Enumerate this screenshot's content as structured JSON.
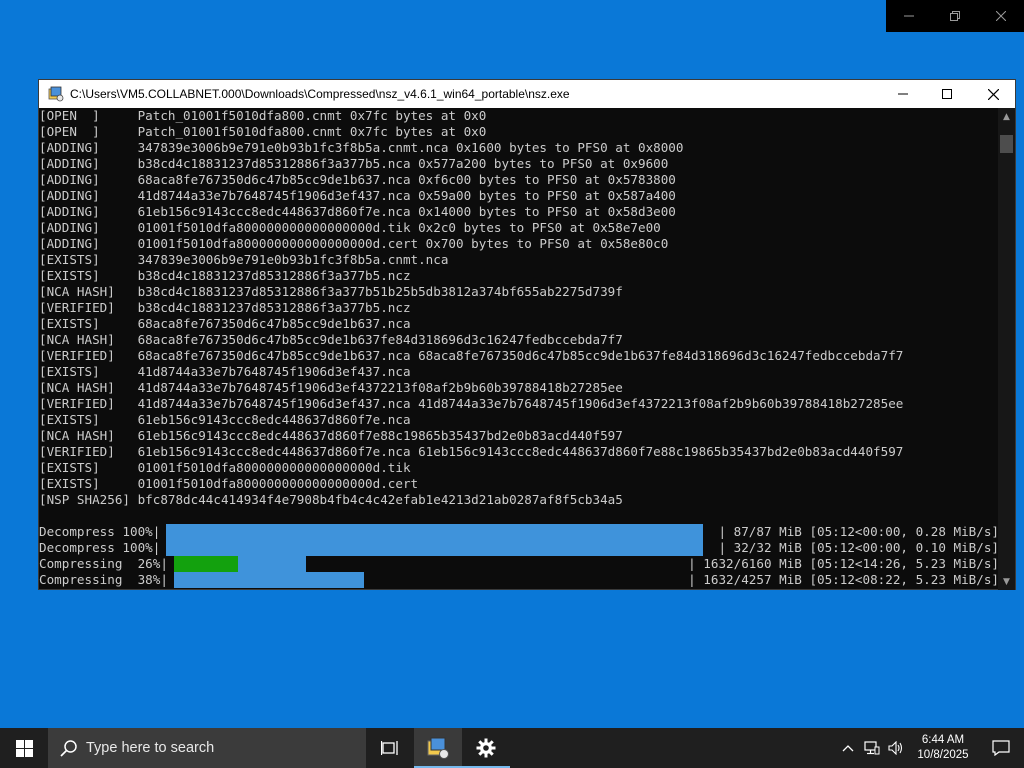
{
  "window": {
    "title": "C:\\Users\\VM5.COLLABNET.000\\Downloads\\Compressed\\nsz_v4.6.1_win64_portable\\nsz.exe"
  },
  "console_lines": [
    "[OPEN  ]     Patch_01001f5010dfa800.cnmt 0x7fc bytes at 0x0",
    "[OPEN  ]     Patch_01001f5010dfa800.cnmt 0x7fc bytes at 0x0",
    "[ADDING]     347839e3006b9e791e0b93b1fc3f8b5a.cnmt.nca 0x1600 bytes to PFS0 at 0x8000",
    "[ADDING]     b38cd4c18831237d85312886f3a377b5.nca 0x577a200 bytes to PFS0 at 0x9600",
    "[ADDING]     68aca8fe767350d6c47b85cc9de1b637.nca 0xf6c00 bytes to PFS0 at 0x5783800",
    "[ADDING]     41d8744a33e7b7648745f1906d3ef437.nca 0x59a00 bytes to PFS0 at 0x587a400",
    "[ADDING]     61eb156c9143ccc8edc448637d860f7e.nca 0x14000 bytes to PFS0 at 0x58d3e00",
    "[ADDING]     01001f5010dfa800000000000000000d.tik 0x2c0 bytes to PFS0 at 0x58e7e00",
    "[ADDING]     01001f5010dfa800000000000000000d.cert 0x700 bytes to PFS0 at 0x58e80c0",
    "[EXISTS]     347839e3006b9e791e0b93b1fc3f8b5a.cnmt.nca",
    "[EXISTS]     b38cd4c18831237d85312886f3a377b5.ncz",
    "[NCA HASH]   b38cd4c18831237d85312886f3a377b51b25b5db3812a374bf655ab2275d739f",
    "[VERIFIED]   b38cd4c18831237d85312886f3a377b5.ncz",
    "[EXISTS]     68aca8fe767350d6c47b85cc9de1b637.nca",
    "[NCA HASH]   68aca8fe767350d6c47b85cc9de1b637fe84d318696d3c16247fedbccebda7f7",
    "[VERIFIED]   68aca8fe767350d6c47b85cc9de1b637.nca 68aca8fe767350d6c47b85cc9de1b637fe84d318696d3c16247fedbccebda7f7",
    "[EXISTS]     41d8744a33e7b7648745f1906d3ef437.nca",
    "[NCA HASH]   41d8744a33e7b7648745f1906d3ef4372213f08af2b9b60b39788418b27285ee",
    "[VERIFIED]   41d8744a33e7b7648745f1906d3ef437.nca 41d8744a33e7b7648745f1906d3ef4372213f08af2b9b60b39788418b27285ee",
    "[EXISTS]     61eb156c9143ccc8edc448637d860f7e.nca",
    "[NCA HASH]   61eb156c9143ccc8edc448637d860f7e88c19865b35437bd2e0b83acd440f597",
    "[VERIFIED]   61eb156c9143ccc8edc448637d860f7e.nca 61eb156c9143ccc8edc448637d860f7e88c19865b35437bd2e0b83acd440f597",
    "[EXISTS]     01001f5010dfa800000000000000000d.tik",
    "[EXISTS]     01001f5010dfa800000000000000000d.cert",
    "[NSP SHA256] bfc878dc44c414934f4e7908b4fb4c4c42efab1e4213d21ab0287af8f5cb34a5"
  ],
  "progress": [
    {
      "label": "Decompress 100%|",
      "stats": "| 87/87 MiB [05:12<00:00, 0.28 MiB/s]",
      "fraction": 1.0,
      "bar_color": "#3f93db",
      "secondary_fraction": 0
    },
    {
      "label": "Decompress 100%|",
      "stats": "| 32/32 MiB [05:12<00:00, 0.10 MiB/s]",
      "fraction": 1.0,
      "bar_color": "#3f93db",
      "secondary_fraction": 0
    },
    {
      "label": "Compressing  26%|",
      "stats": "| 1632/6160 MiB [05:12<14:26, 5.23 MiB/s]",
      "fraction": 0.26,
      "bar_color": "#13a10e",
      "secondary_fraction": 0.265
    },
    {
      "label": "Compressing  38%|",
      "stats": "| 1632/4257 MiB [05:12<08:22, 5.23 MiB/s]",
      "fraction": 0.38,
      "bar_color": "#3f93db",
      "secondary_fraction": 0.383
    }
  ],
  "taskbar": {
    "search_placeholder": "Type here to search",
    "time": "6:44 AM",
    "date": "10/8/2025"
  },
  "colors": {
    "desktop": "#0a78d7",
    "console_bg": "#0c0c0c",
    "console_text": "#cccccc",
    "progress_blue": "#3f93db",
    "progress_green": "#13a10e"
  },
  "icons": {
    "window_icon": "nsz-app-icon",
    "start": "windows-logo-icon",
    "search": "search-icon",
    "taskview": "task-view-icon",
    "settings": "gear-icon"
  }
}
